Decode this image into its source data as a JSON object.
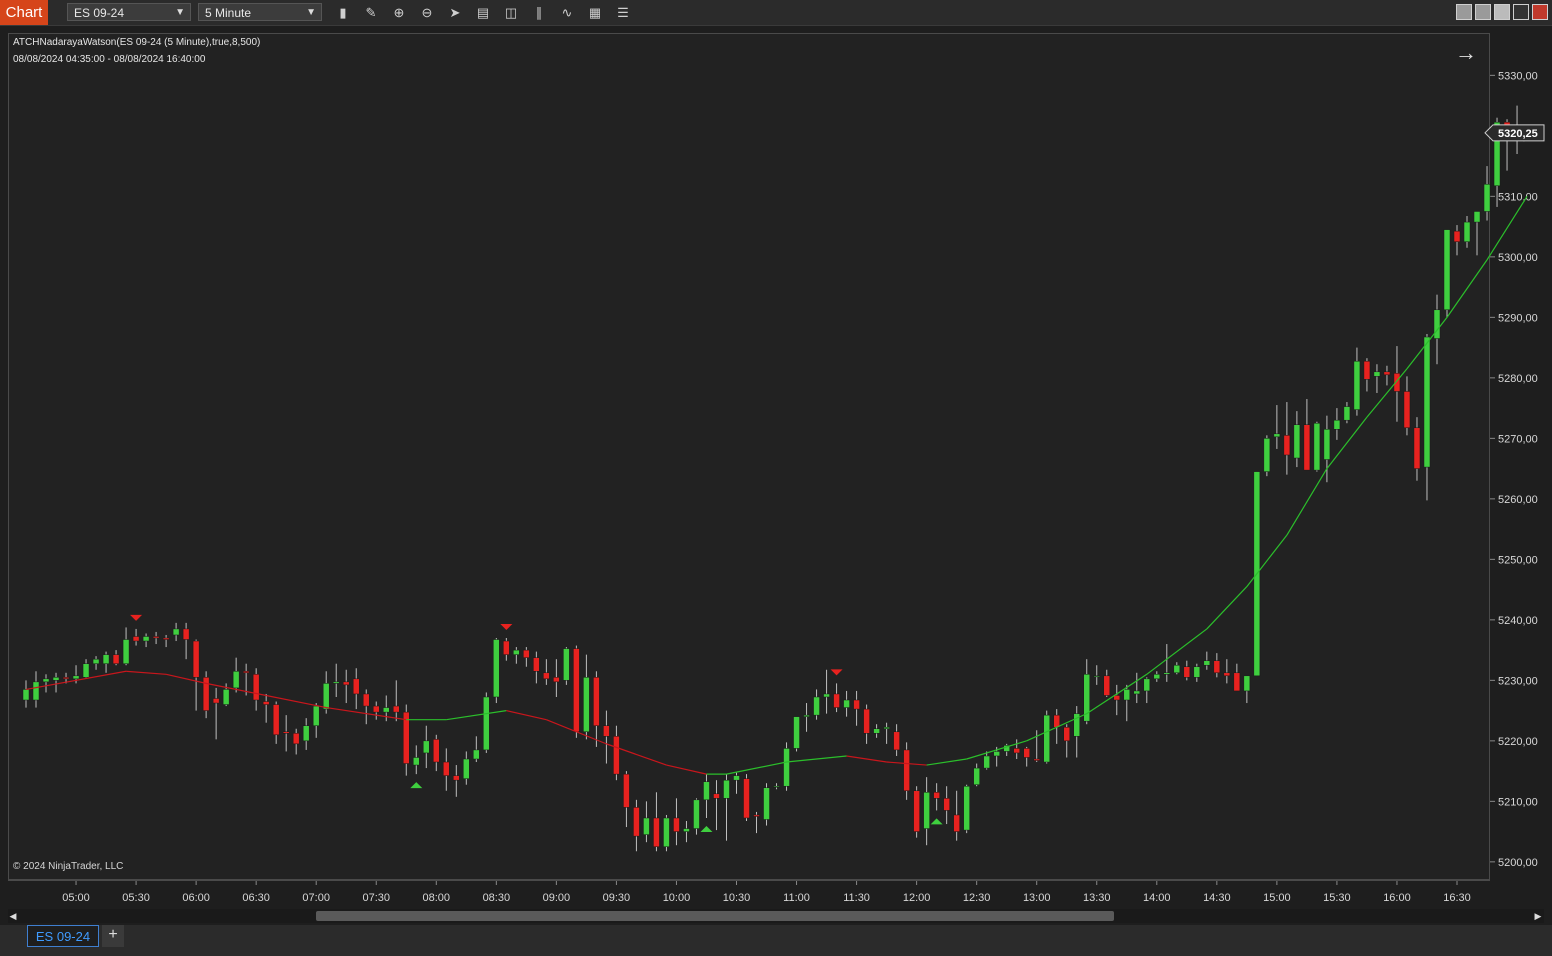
{
  "toolbar": {
    "chart_label": "Chart",
    "instrument": "ES 09-24",
    "interval": "5 Minute",
    "tool_icons": [
      "bar-type-icon",
      "draw-pencil-icon",
      "zoom-in-icon",
      "zoom-out-icon",
      "pointer-icon",
      "data-box-icon",
      "properties-icon",
      "indicators-icon",
      "strategies-icon",
      "templates-icon",
      "menu-list-icon"
    ]
  },
  "indicator": {
    "title": "ATCHNadarayaWatson(ES 09-24 (5 Minute),true,8,500)",
    "range": "08/08/2024 04:35:00 - 08/08/2024 16:40:00"
  },
  "copyright": "© 2024 NinjaTrader, LLC",
  "last_price_label": "5320,25",
  "bottom_tabs": {
    "active": "ES 09-24",
    "add": "+"
  },
  "colors": {
    "up": "#3fcf3f",
    "down": "#e8221f",
    "wick": "#bfbfbf",
    "kernel_up": "#2bbf2b",
    "kernel_down": "#c8161c"
  },
  "chart_data": {
    "type": "candlestick",
    "title": "",
    "x_ticks": [
      "05:00",
      "05:30",
      "06:00",
      "06:30",
      "07:00",
      "07:30",
      "08:00",
      "08:30",
      "09:00",
      "09:30",
      "10:00",
      "10:30",
      "11:00",
      "11:30",
      "12:00",
      "12:30",
      "13:00",
      "13:30",
      "14:00",
      "14:30",
      "15:00",
      "15:30",
      "16:00",
      "16:30"
    ],
    "y_ticks": [
      "5330,00",
      "5320,00",
      "5310,00",
      "5300,00",
      "5290,00",
      "5280,00",
      "5270,00",
      "5260,00",
      "5250,00",
      "5240,00",
      "5230,00",
      "5220,00",
      "5210,00",
      "5200,00"
    ],
    "ylim": [
      5197,
      5337
    ],
    "bar_interval_minutes": 5,
    "first_bar_time": "04:35",
    "candles": [
      {
        "o": 5226.75,
        "h": 5230,
        "l": 5225.5,
        "c": 5228.5
      },
      {
        "o": 5226.75,
        "h": 5231.5,
        "l": 5225.5,
        "c": 5229.75
      },
      {
        "o": 5229.75,
        "h": 5231,
        "l": 5228,
        "c": 5230.25
      },
      {
        "o": 5230,
        "h": 5231.25,
        "l": 5228,
        "c": 5230.5
      },
      {
        "o": 5230.5,
        "h": 5231.25,
        "l": 5229.5,
        "c": 5230.25
      },
      {
        "o": 5230.25,
        "h": 5232.5,
        "l": 5229.5,
        "c": 5230.75
      },
      {
        "o": 5230.5,
        "h": 5233.5,
        "l": 5230.25,
        "c": 5232.75
      },
      {
        "o": 5232.75,
        "h": 5234,
        "l": 5231.75,
        "c": 5233.5
      },
      {
        "o": 5232.75,
        "h": 5234.75,
        "l": 5231.25,
        "c": 5234.25
      },
      {
        "o": 5234.25,
        "h": 5235,
        "l": 5232.5,
        "c": 5232.75
      },
      {
        "o": 5232.75,
        "h": 5238.75,
        "l": 5232.5,
        "c": 5236.75
      },
      {
        "o": 5237.25,
        "h": 5238.5,
        "l": 5235.75,
        "c": 5236.5
      },
      {
        "o": 5236.5,
        "h": 5237.75,
        "l": 5235.5,
        "c": 5237.25
      },
      {
        "o": 5237.25,
        "h": 5238,
        "l": 5236,
        "c": 5237
      },
      {
        "o": 5237,
        "h": 5237.5,
        "l": 5235.5,
        "c": 5236.75
      },
      {
        "o": 5237.5,
        "h": 5239.5,
        "l": 5236.5,
        "c": 5238.5
      },
      {
        "o": 5238.5,
        "h": 5239.5,
        "l": 5233.5,
        "c": 5236.75
      },
      {
        "o": 5236.5,
        "h": 5236.75,
        "l": 5225,
        "c": 5230.5
      },
      {
        "o": 5230.5,
        "h": 5231.5,
        "l": 5223.75,
        "c": 5225
      },
      {
        "o": 5227,
        "h": 5228.75,
        "l": 5220.25,
        "c": 5226.25
      },
      {
        "o": 5226,
        "h": 5229.5,
        "l": 5225.75,
        "c": 5228.5
      },
      {
        "o": 5228.75,
        "h": 5233.75,
        "l": 5228,
        "c": 5231.5
      },
      {
        "o": 5231.5,
        "h": 5232.75,
        "l": 5227.5,
        "c": 5231.25
      },
      {
        "o": 5231,
        "h": 5232,
        "l": 5225,
        "c": 5226.75
      },
      {
        "o": 5226.5,
        "h": 5227.75,
        "l": 5223,
        "c": 5226
      },
      {
        "o": 5226,
        "h": 5226.5,
        "l": 5219.5,
        "c": 5221
      },
      {
        "o": 5221.5,
        "h": 5224.25,
        "l": 5218.25,
        "c": 5221.25
      },
      {
        "o": 5221.25,
        "h": 5222,
        "l": 5217.75,
        "c": 5219.5
      },
      {
        "o": 5220,
        "h": 5223.75,
        "l": 5218.5,
        "c": 5222.5
      },
      {
        "o": 5222.5,
        "h": 5226.25,
        "l": 5220.5,
        "c": 5225.75
      },
      {
        "o": 5225.25,
        "h": 5231.5,
        "l": 5224.5,
        "c": 5229.5
      },
      {
        "o": 5229.5,
        "h": 5232.75,
        "l": 5227.25,
        "c": 5229.75
      },
      {
        "o": 5229.75,
        "h": 5231.75,
        "l": 5226.25,
        "c": 5229.25
      },
      {
        "o": 5230.25,
        "h": 5232,
        "l": 5225.25,
        "c": 5227.75
      },
      {
        "o": 5227.75,
        "h": 5228.5,
        "l": 5222.75,
        "c": 5225.75
      },
      {
        "o": 5225.75,
        "h": 5226.5,
        "l": 5223.5,
        "c": 5224.75
      },
      {
        "o": 5224.75,
        "h": 5227.5,
        "l": 5223.25,
        "c": 5225.5
      },
      {
        "o": 5225.75,
        "h": 5230,
        "l": 5223.25,
        "c": 5224.75
      },
      {
        "o": 5224.75,
        "h": 5226,
        "l": 5214.25,
        "c": 5216.25
      },
      {
        "o": 5216,
        "h": 5219.25,
        "l": 5214.5,
        "c": 5217.25
      },
      {
        "o": 5218,
        "h": 5222.5,
        "l": 5215.5,
        "c": 5220
      },
      {
        "o": 5220.25,
        "h": 5221,
        "l": 5215,
        "c": 5216.5
      },
      {
        "o": 5216.5,
        "h": 5218.75,
        "l": 5211.75,
        "c": 5214.25
      },
      {
        "o": 5214.25,
        "h": 5216,
        "l": 5210.75,
        "c": 5213.5
      },
      {
        "o": 5213.75,
        "h": 5218.25,
        "l": 5212.75,
        "c": 5217
      },
      {
        "o": 5217,
        "h": 5220.75,
        "l": 5216.5,
        "c": 5218.5
      },
      {
        "o": 5218.5,
        "h": 5228,
        "l": 5218,
        "c": 5227.25
      },
      {
        "o": 5227.25,
        "h": 5237,
        "l": 5226.25,
        "c": 5236.75
      },
      {
        "o": 5236.5,
        "h": 5237,
        "l": 5233.25,
        "c": 5234.25
      },
      {
        "o": 5234.25,
        "h": 5235.5,
        "l": 5232.75,
        "c": 5235
      },
      {
        "o": 5235,
        "h": 5235.5,
        "l": 5232.25,
        "c": 5233.75
      },
      {
        "o": 5233.75,
        "h": 5234.75,
        "l": 5229.5,
        "c": 5231.5
      },
      {
        "o": 5231.25,
        "h": 5233.5,
        "l": 5229.25,
        "c": 5230.25
      },
      {
        "o": 5230.5,
        "h": 5233.5,
        "l": 5227.25,
        "c": 5229.75
      },
      {
        "o": 5230,
        "h": 5235.5,
        "l": 5229.25,
        "c": 5235.25
      },
      {
        "o": 5235.25,
        "h": 5235.75,
        "l": 5220.5,
        "c": 5221.5
      },
      {
        "o": 5221.5,
        "h": 5234.25,
        "l": 5220.25,
        "c": 5230.5
      },
      {
        "o": 5230.5,
        "h": 5231.5,
        "l": 5219,
        "c": 5222.5
      },
      {
        "o": 5222.5,
        "h": 5225,
        "l": 5216.25,
        "c": 5220.75
      },
      {
        "o": 5220.75,
        "h": 5222.5,
        "l": 5213.5,
        "c": 5214.5
      },
      {
        "o": 5214.5,
        "h": 5215,
        "l": 5205.75,
        "c": 5209
      },
      {
        "o": 5209,
        "h": 5210.25,
        "l": 5201.75,
        "c": 5204.25
      },
      {
        "o": 5204.5,
        "h": 5210,
        "l": 5203.25,
        "c": 5207.25
      },
      {
        "o": 5207.25,
        "h": 5211.5,
        "l": 5201.75,
        "c": 5202.5
      },
      {
        "o": 5202.5,
        "h": 5207.75,
        "l": 5201.75,
        "c": 5207.25
      },
      {
        "o": 5207.25,
        "h": 5210.5,
        "l": 5202.75,
        "c": 5205
      },
      {
        "o": 5205,
        "h": 5206.75,
        "l": 5203.25,
        "c": 5205.5
      },
      {
        "o": 5205.5,
        "h": 5210.5,
        "l": 5204.5,
        "c": 5210.25
      },
      {
        "o": 5210.25,
        "h": 5214.5,
        "l": 5207.25,
        "c": 5213.25
      },
      {
        "o": 5211.25,
        "h": 5213.5,
        "l": 5205.25,
        "c": 5210.5
      },
      {
        "o": 5210.5,
        "h": 5214.5,
        "l": 5203.5,
        "c": 5213.5
      },
      {
        "o": 5213.5,
        "h": 5214.75,
        "l": 5211.25,
        "c": 5214.25
      },
      {
        "o": 5213.75,
        "h": 5214.5,
        "l": 5206.75,
        "c": 5207.25
      },
      {
        "o": 5207.75,
        "h": 5208.25,
        "l": 5204.75,
        "c": 5207.5
      },
      {
        "o": 5207,
        "h": 5213,
        "l": 5206,
        "c": 5212.25
      },
      {
        "o": 5212.5,
        "h": 5213,
        "l": 5212,
        "c": 5212.5
      },
      {
        "o": 5212.5,
        "h": 5219.75,
        "l": 5211.75,
        "c": 5218.75
      },
      {
        "o": 5218.75,
        "h": 5223.5,
        "l": 5218.25,
        "c": 5224
      },
      {
        "o": 5224,
        "h": 5226.25,
        "l": 5221.5,
        "c": 5224.25
      },
      {
        "o": 5224.25,
        "h": 5228.5,
        "l": 5223.5,
        "c": 5227.25
      },
      {
        "o": 5227.25,
        "h": 5231.75,
        "l": 5224.5,
        "c": 5227.75
      },
      {
        "o": 5227.75,
        "h": 5229.5,
        "l": 5224.75,
        "c": 5225.5
      },
      {
        "o": 5225.5,
        "h": 5228.25,
        "l": 5224,
        "c": 5226.75
      },
      {
        "o": 5226.75,
        "h": 5228.25,
        "l": 5222.5,
        "c": 5225.25
      },
      {
        "o": 5225.25,
        "h": 5226,
        "l": 5219.5,
        "c": 5221.25
      },
      {
        "o": 5221.25,
        "h": 5222.75,
        "l": 5220.5,
        "c": 5222
      },
      {
        "o": 5222,
        "h": 5223,
        "l": 5219.5,
        "c": 5222.25
      },
      {
        "o": 5221.5,
        "h": 5222.75,
        "l": 5217.5,
        "c": 5218.5
      },
      {
        "o": 5218.5,
        "h": 5219.75,
        "l": 5210.25,
        "c": 5211.75
      },
      {
        "o": 5211.75,
        "h": 5212.5,
        "l": 5204,
        "c": 5205
      },
      {
        "o": 5205.5,
        "h": 5214,
        "l": 5202.75,
        "c": 5211.5
      },
      {
        "o": 5211.5,
        "h": 5213,
        "l": 5208.5,
        "c": 5210.5
      },
      {
        "o": 5210.5,
        "h": 5212.5,
        "l": 5206.25,
        "c": 5208.5
      },
      {
        "o": 5207.75,
        "h": 5211.75,
        "l": 5203.5,
        "c": 5205
      },
      {
        "o": 5205.25,
        "h": 5212.75,
        "l": 5204.75,
        "c": 5212.5
      },
      {
        "o": 5212.75,
        "h": 5216.25,
        "l": 5212.5,
        "c": 5215.5
      },
      {
        "o": 5215.5,
        "h": 5218.25,
        "l": 5215.25,
        "c": 5217.5
      },
      {
        "o": 5217.5,
        "h": 5219,
        "l": 5215.75,
        "c": 5218.25
      },
      {
        "o": 5218.25,
        "h": 5219.5,
        "l": 5217.5,
        "c": 5219.25
      },
      {
        "o": 5218.75,
        "h": 5220.25,
        "l": 5217,
        "c": 5218
      },
      {
        "o": 5218.75,
        "h": 5219,
        "l": 5215.75,
        "c": 5217.25
      },
      {
        "o": 5217,
        "h": 5221.75,
        "l": 5216.5,
        "c": 5216.75
      },
      {
        "o": 5216.5,
        "h": 5225,
        "l": 5216.25,
        "c": 5224.25
      },
      {
        "o": 5224.25,
        "h": 5225.25,
        "l": 5219.5,
        "c": 5222.25
      },
      {
        "o": 5222.25,
        "h": 5222.75,
        "l": 5217.25,
        "c": 5220
      },
      {
        "o": 5220.75,
        "h": 5225.75,
        "l": 5217.25,
        "c": 5224.5
      },
      {
        "o": 5223.25,
        "h": 5233.5,
        "l": 5222.75,
        "c": 5231
      },
      {
        "o": 5230.75,
        "h": 5232.5,
        "l": 5229.25,
        "c": 5230.75
      },
      {
        "o": 5230.75,
        "h": 5231.75,
        "l": 5227.25,
        "c": 5227.5
      },
      {
        "o": 5227.5,
        "h": 5229.25,
        "l": 5224.25,
        "c": 5226.75
      },
      {
        "o": 5226.75,
        "h": 5229.25,
        "l": 5223.25,
        "c": 5228.5
      },
      {
        "o": 5227.75,
        "h": 5231.25,
        "l": 5226.25,
        "c": 5228.25
      },
      {
        "o": 5228.25,
        "h": 5230.5,
        "l": 5226.25,
        "c": 5230.25
      },
      {
        "o": 5230.25,
        "h": 5231.5,
        "l": 5229.75,
        "c": 5231
      },
      {
        "o": 5231,
        "h": 5236,
        "l": 5229.75,
        "c": 5231.25
      },
      {
        "o": 5231.25,
        "h": 5233,
        "l": 5231,
        "c": 5232.5
      },
      {
        "o": 5232.25,
        "h": 5233.25,
        "l": 5230,
        "c": 5230.5
      },
      {
        "o": 5230.5,
        "h": 5232.75,
        "l": 5229.75,
        "c": 5232.25
      },
      {
        "o": 5232.5,
        "h": 5234.75,
        "l": 5231.75,
        "c": 5233.25
      },
      {
        "o": 5233.25,
        "h": 5234.5,
        "l": 5230.5,
        "c": 5231.25
      },
      {
        "o": 5231.25,
        "h": 5233.5,
        "l": 5229.5,
        "c": 5230.75
      },
      {
        "o": 5231.25,
        "h": 5232.75,
        "l": 5229.25,
        "c": 5228.25
      },
      {
        "o": 5228.25,
        "h": 5230.5,
        "l": 5226.25,
        "c": 5230.75
      },
      {
        "o": 5230.75,
        "h": 5264.5,
        "l": 5230.75,
        "c": 5264.5
      },
      {
        "o": 5264.5,
        "h": 5270.5,
        "l": 5263.75,
        "c": 5270
      },
      {
        "o": 5270.25,
        "h": 5275.5,
        "l": 5268.25,
        "c": 5270.75
      },
      {
        "o": 5270.5,
        "h": 5276,
        "l": 5264,
        "c": 5267.25
      },
      {
        "o": 5266.75,
        "h": 5274.5,
        "l": 5265.25,
        "c": 5272.25
      },
      {
        "o": 5272.25,
        "h": 5276.5,
        "l": 5266.5,
        "c": 5264.75
      },
      {
        "o": 5264.75,
        "h": 5272.75,
        "l": 5264.5,
        "c": 5272.5
      },
      {
        "o": 5266.5,
        "h": 5273.75,
        "l": 5262.75,
        "c": 5271.5
      },
      {
        "o": 5271.5,
        "h": 5275,
        "l": 5269.75,
        "c": 5273
      },
      {
        "o": 5273,
        "h": 5276,
        "l": 5272.5,
        "c": 5275.25
      },
      {
        "o": 5274.75,
        "h": 5285,
        "l": 5273.75,
        "c": 5282.75
      },
      {
        "o": 5282.75,
        "h": 5283.25,
        "l": 5277.75,
        "c": 5279.75
      },
      {
        "o": 5280.25,
        "h": 5282.25,
        "l": 5277.5,
        "c": 5281
      },
      {
        "o": 5281,
        "h": 5282,
        "l": 5278.75,
        "c": 5280.5
      },
      {
        "o": 5280.75,
        "h": 5285.25,
        "l": 5272.75,
        "c": 5277.75
      },
      {
        "o": 5277.75,
        "h": 5280.25,
        "l": 5270.5,
        "c": 5271.75
      },
      {
        "o": 5271.75,
        "h": 5273.5,
        "l": 5263,
        "c": 5265
      },
      {
        "o": 5265.25,
        "h": 5287.25,
        "l": 5259.75,
        "c": 5286.75
      },
      {
        "o": 5286.5,
        "h": 5293.75,
        "l": 5282.25,
        "c": 5291.25
      },
      {
        "o": 5291.25,
        "h": 5303.75,
        "l": 5290,
        "c": 5304.5
      },
      {
        "o": 5304.25,
        "h": 5305.25,
        "l": 5300.25,
        "c": 5302.5
      },
      {
        "o": 5302.5,
        "h": 5306.75,
        "l": 5301.5,
        "c": 5305.75
      },
      {
        "o": 5305.75,
        "h": 5306.75,
        "l": 5300.25,
        "c": 5307.5
      },
      {
        "o": 5307.5,
        "h": 5315,
        "l": 5306,
        "c": 5312
      },
      {
        "o": 5311.75,
        "h": 5323,
        "l": 5308.25,
        "c": 5322.25
      },
      {
        "o": 5322.25,
        "h": 5322.75,
        "l": 5314.25,
        "c": 5320.25
      },
      {
        "o": 5320.25,
        "h": 5325,
        "l": 5317,
        "c": 5320.5
      }
    ],
    "kernel_line": [
      {
        "i": 0,
        "v": 5228.5,
        "c": "down"
      },
      {
        "i": 10,
        "v": 5231.5,
        "c": "down"
      },
      {
        "i": 14,
        "v": 5231,
        "c": "down"
      },
      {
        "i": 18,
        "v": 5229.5,
        "c": "down"
      },
      {
        "i": 24,
        "v": 5227.5,
        "c": "down"
      },
      {
        "i": 30,
        "v": 5225.5,
        "c": "down"
      },
      {
        "i": 36,
        "v": 5224,
        "c": "down"
      },
      {
        "i": 38,
        "v": 5223.5,
        "c": "down"
      },
      {
        "i": 42,
        "v": 5223.5,
        "c": "up"
      },
      {
        "i": 48,
        "v": 5225,
        "c": "up"
      },
      {
        "i": 52,
        "v": 5223.5,
        "c": "down"
      },
      {
        "i": 58,
        "v": 5219.5,
        "c": "down"
      },
      {
        "i": 64,
        "v": 5216,
        "c": "down"
      },
      {
        "i": 68,
        "v": 5214.5,
        "c": "down"
      },
      {
        "i": 70,
        "v": 5214.5,
        "c": "up"
      },
      {
        "i": 76,
        "v": 5216.5,
        "c": "up"
      },
      {
        "i": 82,
        "v": 5217.5,
        "c": "up"
      },
      {
        "i": 86,
        "v": 5216.5,
        "c": "down"
      },
      {
        "i": 90,
        "v": 5216,
        "c": "down"
      },
      {
        "i": 94,
        "v": 5217,
        "c": "up"
      },
      {
        "i": 100,
        "v": 5220,
        "c": "up"
      },
      {
        "i": 106,
        "v": 5224.5,
        "c": "up"
      },
      {
        "i": 112,
        "v": 5231,
        "c": "up"
      },
      {
        "i": 118,
        "v": 5238.5,
        "c": "up"
      },
      {
        "i": 122,
        "v": 5245.5,
        "c": "up"
      },
      {
        "i": 126,
        "v": 5254,
        "c": "up"
      },
      {
        "i": 130,
        "v": 5265,
        "c": "up"
      },
      {
        "i": 134,
        "v": 5273.5,
        "c": "up"
      },
      {
        "i": 138,
        "v": 5281.5,
        "c": "up"
      },
      {
        "i": 142,
        "v": 5290,
        "c": "up"
      },
      {
        "i": 146,
        "v": 5299.5,
        "c": "up"
      },
      {
        "i": 150,
        "v": 5310,
        "c": "up"
      }
    ],
    "signals": [
      {
        "i": 11,
        "type": "sell"
      },
      {
        "i": 48,
        "type": "sell"
      },
      {
        "i": 81,
        "type": "sell"
      },
      {
        "i": 39,
        "type": "buy"
      },
      {
        "i": 68,
        "type": "buy"
      },
      {
        "i": 91,
        "type": "buy"
      }
    ]
  }
}
